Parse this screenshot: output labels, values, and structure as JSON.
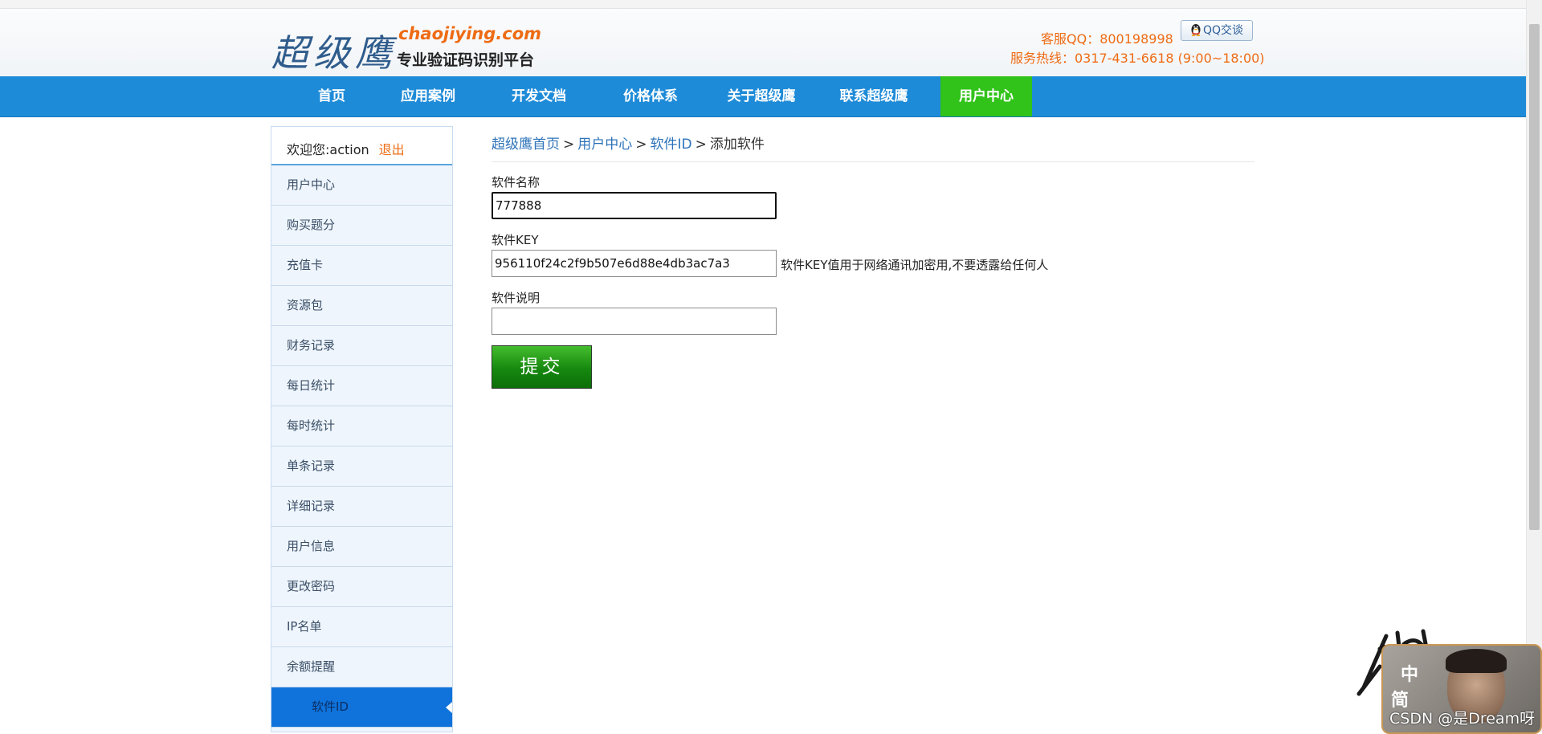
{
  "header": {
    "logo_text": "超级鹰",
    "logo_domain": "chaojiying.com",
    "tagline": "专业验证码识别平台",
    "service_qq": "客服QQ：800198998",
    "qq_button": "QQ交谈",
    "hotline": "服务热线：0317-431-6618 (9:00~18:00)"
  },
  "nav": {
    "items": [
      {
        "label": "首页"
      },
      {
        "label": "应用案例"
      },
      {
        "label": "开发文档"
      },
      {
        "label": "价格体系"
      },
      {
        "label": "关于超级鹰"
      },
      {
        "label": "联系超级鹰"
      },
      {
        "label": "用户中心"
      }
    ]
  },
  "sidebar": {
    "welcome": "欢迎您:action",
    "logout": "退出",
    "items": [
      {
        "label": "用户中心"
      },
      {
        "label": "购买题分"
      },
      {
        "label": "充值卡"
      },
      {
        "label": "资源包"
      },
      {
        "label": "财务记录"
      },
      {
        "label": "每日统计"
      },
      {
        "label": "每时统计"
      },
      {
        "label": "单条记录"
      },
      {
        "label": "详细记录"
      },
      {
        "label": "用户信息"
      },
      {
        "label": "更改密码"
      },
      {
        "label": "IP名单"
      },
      {
        "label": "余额提醒"
      },
      {
        "label": "软件ID"
      }
    ]
  },
  "breadcrumb": {
    "home": "超级鹰首页",
    "user_center": "用户中心",
    "software_id": "软件ID",
    "sep": ">",
    "current": "添加软件"
  },
  "form": {
    "name_label": "软件名称",
    "name_value": "777888",
    "key_label": "软件KEY",
    "key_value": "956110f24c2f9b507e6d88e4db3ac7a3",
    "key_hint": "软件KEY值用于网络通讯加密用,不要透露给任何人",
    "desc_label": "软件说明",
    "desc_value": "",
    "submit_label": "提交"
  },
  "watermark": {
    "csdn": "CSDN @是Dream呀",
    "char_1": "中",
    "char_2": "简"
  },
  "colors": {
    "nav_bg": "#1e8bd8",
    "nav_active": "#31c31a",
    "accent_orange": "#ee6b14",
    "link_blue": "#2d73b9",
    "sidebar_active": "#0f73db",
    "submit_green": "#16880f"
  }
}
